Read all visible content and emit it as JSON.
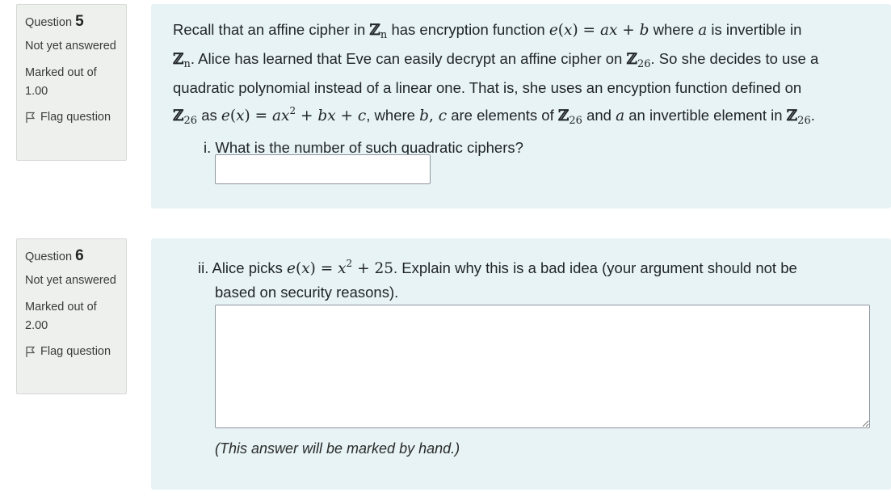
{
  "q5": {
    "label": "Question",
    "number": "5",
    "state": "Not yet answered",
    "grade": "Marked out of 1.00",
    "flag": "Flag question",
    "text": {
      "l1_a": "Recall that an affine cipher in",
      "l1_b": "has encryption function",
      "l1_c": "where",
      "l1_d": "is invertible in",
      "l2_a": ". Alice has learned that Eve can easily decrypt an affine cipher on",
      "l2_b": ". So she decides to use a",
      "l3": "quadratic polynomial instead of a linear one. That is, she uses an encyption function defined on",
      "l4_a": "as",
      "l4_b": ", where",
      "l4_c": "are elements of",
      "l4_d": "and",
      "l4_e": "an invertible element in",
      "l4_f": "."
    },
    "sub_question": "i. What is the number of such quadratic ciphers?",
    "answer_value": ""
  },
  "q6": {
    "label": "Question",
    "number": "6",
    "state": "Not yet answered",
    "grade": "Marked out of 2.00",
    "flag": "Flag question",
    "sub_question_a": "ii. Alice picks",
    "sub_question_b": ". Explain why this is a bad idea (your argument should not be",
    "sub_question_c": "based on security reasons).",
    "answer_value": "",
    "hand_note": "(This answer will be marked by hand.)"
  }
}
